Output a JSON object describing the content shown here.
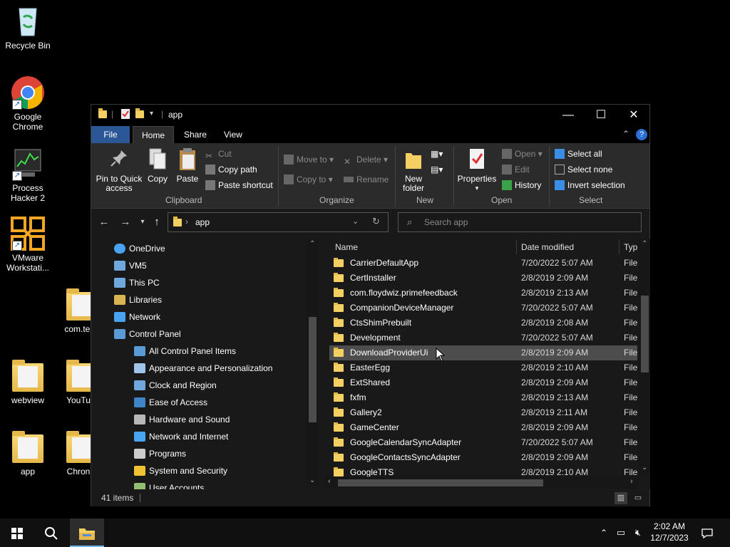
{
  "desktop": {
    "icons": [
      {
        "label": "Recycle Bin"
      },
      {
        "label": "Google Chrome"
      },
      {
        "label": "Process Hacker 2"
      },
      {
        "label": "VMware Workstati..."
      },
      {
        "label": "com.ter..."
      },
      {
        "label": "webview"
      },
      {
        "label": "YouTu..."
      },
      {
        "label": "app"
      },
      {
        "label": "Chron..."
      }
    ]
  },
  "window": {
    "title": "app",
    "controls": {
      "minimize": "—",
      "maximize": "☐",
      "close": "✕"
    }
  },
  "ribbon_tabs": [
    "File",
    "Home",
    "Share",
    "View"
  ],
  "ribbon": {
    "clipboard": {
      "label": "Clipboard",
      "pin": "Pin to Quick access",
      "pin_l1": "Pin to Quick",
      "pin_l2": "access",
      "copy": "Copy",
      "paste": "Paste",
      "cut": "Cut",
      "copy_path": "Copy path",
      "paste_shortcut": "Paste shortcut"
    },
    "organize": {
      "label": "Organize",
      "move_to": "Move to",
      "copy_to": "Copy to",
      "delete": "Delete",
      "rename": "Rename"
    },
    "new": {
      "label": "New",
      "new_folder_l1": "New",
      "new_folder_l2": "folder"
    },
    "open": {
      "label": "Open",
      "properties": "Properties",
      "open": "Open",
      "edit": "Edit",
      "history": "History"
    },
    "select": {
      "label": "Select",
      "select_all": "Select all",
      "select_none": "Select none",
      "invert": "Invert selection"
    }
  },
  "address": {
    "path": "app",
    "search_placeholder": "Search app"
  },
  "nav_tree": [
    {
      "label": "OneDrive",
      "icon": "cloud-icon",
      "indent": 0
    },
    {
      "label": "VM5",
      "icon": "network-folder-icon",
      "indent": 0
    },
    {
      "label": "This PC",
      "icon": "computer-icon",
      "indent": 0
    },
    {
      "label": "Libraries",
      "icon": "libraries-icon",
      "indent": 0
    },
    {
      "label": "Network",
      "icon": "network-icon",
      "indent": 0
    },
    {
      "label": "Control Panel",
      "icon": "control-panel-icon",
      "indent": 0
    },
    {
      "label": "All Control Panel Items",
      "icon": "control-panel-icon",
      "indent": 1
    },
    {
      "label": "Appearance and Personalization",
      "icon": "appearance-icon",
      "indent": 1
    },
    {
      "label": "Clock and Region",
      "icon": "clock-icon",
      "indent": 1
    },
    {
      "label": "Ease of Access",
      "icon": "ease-of-access-icon",
      "indent": 1
    },
    {
      "label": "Hardware and Sound",
      "icon": "hardware-icon",
      "indent": 1
    },
    {
      "label": "Network and Internet",
      "icon": "network-icon",
      "indent": 1
    },
    {
      "label": "Programs",
      "icon": "programs-icon",
      "indent": 1
    },
    {
      "label": "System and Security",
      "icon": "security-icon",
      "indent": 1
    },
    {
      "label": "User Accounts",
      "icon": "user-icon",
      "indent": 1
    }
  ],
  "columns": {
    "name": "Name",
    "date": "Date modified",
    "type": "Typ"
  },
  "files": [
    {
      "name": "CarrierDefaultApp",
      "date": "7/20/2022 5:07 AM",
      "type": "File"
    },
    {
      "name": "CertInstaller",
      "date": "2/8/2019 2:09 AM",
      "type": "File"
    },
    {
      "name": "com.floydwiz.primefeedback",
      "date": "2/8/2019 2:13 AM",
      "type": "File"
    },
    {
      "name": "CompanionDeviceManager",
      "date": "7/20/2022 5:07 AM",
      "type": "File"
    },
    {
      "name": "CtsShimPrebuilt",
      "date": "2/8/2019 2:08 AM",
      "type": "File"
    },
    {
      "name": "Development",
      "date": "7/20/2022 5:07 AM",
      "type": "File"
    },
    {
      "name": "DownloadProviderUi",
      "date": "2/8/2019 2:09 AM",
      "type": "File"
    },
    {
      "name": "EasterEgg",
      "date": "2/8/2019 2:10 AM",
      "type": "File"
    },
    {
      "name": "ExtShared",
      "date": "2/8/2019 2:09 AM",
      "type": "File"
    },
    {
      "name": "fxfm",
      "date": "2/8/2019 2:13 AM",
      "type": "File"
    },
    {
      "name": "Gallery2",
      "date": "2/8/2019 2:11 AM",
      "type": "File"
    },
    {
      "name": "GameCenter",
      "date": "2/8/2019 2:09 AM",
      "type": "File"
    },
    {
      "name": "GoogleCalendarSyncAdapter",
      "date": "7/20/2022 5:07 AM",
      "type": "File"
    },
    {
      "name": "GoogleContactsSyncAdapter",
      "date": "2/8/2019 2:09 AM",
      "type": "File"
    },
    {
      "name": "GoogleTTS",
      "date": "2/8/2019 2:10 AM",
      "type": "File"
    }
  ],
  "hover_index": 6,
  "status": {
    "items": "41 items"
  },
  "taskbar": {
    "time": "2:02 AM",
    "date": "12/7/2023"
  }
}
